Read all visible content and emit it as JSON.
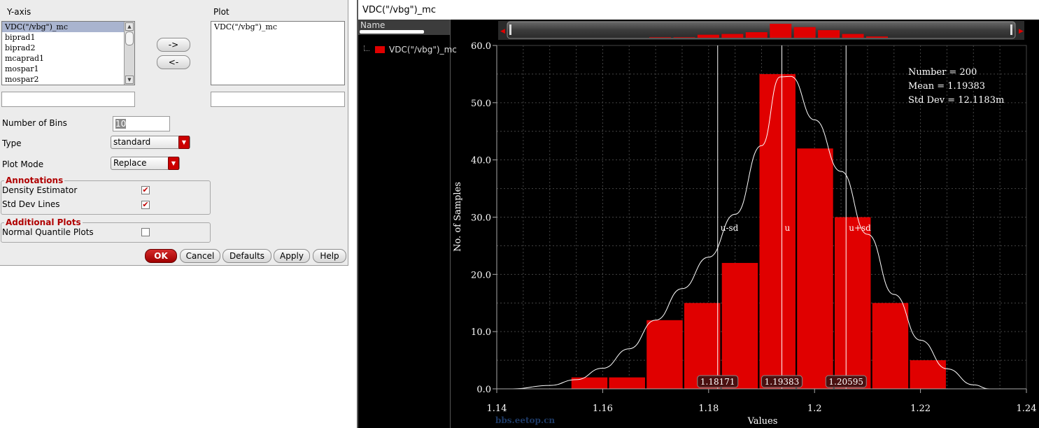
{
  "dialog": {
    "yaxis_label": "Y-axis",
    "plot_label": "Plot",
    "yaxis_items": [
      {
        "label": "VDC(\"/vbg\")_mc",
        "selected": true
      },
      {
        "label": "biprad1",
        "selected": false
      },
      {
        "label": "biprad2",
        "selected": false
      },
      {
        "label": "mcaprad1",
        "selected": false
      },
      {
        "label": "mospar1",
        "selected": false
      },
      {
        "label": "mospar2",
        "selected": false
      }
    ],
    "plot_items": [
      "VDC(\"/vbg\")_mc"
    ],
    "add_button": "->",
    "remove_button": "<-",
    "bins_label": "Number of Bins",
    "bins_value": "10",
    "type_label": "Type",
    "type_value": "standard",
    "plot_mode_label": "Plot Mode",
    "plot_mode_value": "Replace",
    "annotations_title": "Annotations",
    "density_label": "Density Estimator",
    "density_checked": true,
    "stddev_label": "Std Dev Lines",
    "stddev_checked": true,
    "additional_title": "Additional Plots",
    "quantile_label": "Normal Quantile Plots",
    "quantile_checked": false,
    "buttons": {
      "ok": "OK",
      "cancel": "Cancel",
      "defaults": "Defaults",
      "apply": "Apply",
      "help": "Help"
    }
  },
  "plot_window": {
    "title": "VDC(\"/vbg\")_mc",
    "legend_header": "Name",
    "legend_item": "VDC(\"/vbg\")_mc",
    "series_color": "#e00000",
    "watermark": "bbs.eetop.cn"
  },
  "chart_data": {
    "type": "bar",
    "xlabel": "Values",
    "ylabel": "No. of Samples",
    "xlim": [
      1.14,
      1.24
    ],
    "ylim": [
      0,
      60
    ],
    "xticks": [
      1.14,
      1.16,
      1.18,
      1.2,
      1.22,
      1.24
    ],
    "xtick_labels": [
      "1.14",
      "1.16",
      "1.18",
      "1.2",
      "1.22",
      "1.24"
    ],
    "yticks": [
      0,
      10,
      20,
      30,
      40,
      50,
      60
    ],
    "ytick_labels": [
      "0.0",
      "10.0",
      "20.0",
      "30.0",
      "40.0",
      "50.0",
      "60.0"
    ],
    "bins": [
      {
        "x0": 1.1541,
        "x1": 1.1609,
        "count": 2
      },
      {
        "x0": 1.1612,
        "x1": 1.168,
        "count": 2
      },
      {
        "x0": 1.1683,
        "x1": 1.1751,
        "count": 12
      },
      {
        "x0": 1.1754,
        "x1": 1.1822,
        "count": 15
      },
      {
        "x0": 1.1825,
        "x1": 1.1893,
        "count": 22
      },
      {
        "x0": 1.1896,
        "x1": 1.1964,
        "count": 55
      },
      {
        "x0": 1.1967,
        "x1": 1.2035,
        "count": 42
      },
      {
        "x0": 1.2038,
        "x1": 1.2106,
        "count": 30
      },
      {
        "x0": 1.2109,
        "x1": 1.2177,
        "count": 15
      },
      {
        "x0": 1.218,
        "x1": 1.2248,
        "count": 5
      }
    ],
    "density_curve": [
      [
        1.143,
        0.0
      ],
      [
        1.15,
        0.6
      ],
      [
        1.155,
        1.6
      ],
      [
        1.16,
        3.6
      ],
      [
        1.165,
        7.0
      ],
      [
        1.17,
        12.0
      ],
      [
        1.175,
        17.5
      ],
      [
        1.18,
        23.0
      ],
      [
        1.185,
        30.5
      ],
      [
        1.19,
        42.5
      ],
      [
        1.1935,
        54.5
      ],
      [
        1.1955,
        54.6
      ],
      [
        1.2,
        47.0
      ],
      [
        1.205,
        38.0
      ],
      [
        1.21,
        27.0
      ],
      [
        1.215,
        16.5
      ],
      [
        1.22,
        8.5
      ],
      [
        1.225,
        3.5
      ],
      [
        1.23,
        0.7
      ],
      [
        1.233,
        0.0
      ]
    ],
    "stddev_lines": [
      {
        "x": 1.18171,
        "label": "u-sd",
        "value_label": "1.18171"
      },
      {
        "x": 1.19383,
        "label": "u",
        "value_label": "1.19383"
      },
      {
        "x": 1.20595,
        "label": "u+sd",
        "value_label": "1.20595"
      }
    ],
    "stats": [
      "Number = 200",
      "Mean = 1.19383",
      "Std Dev = 12.1183m"
    ],
    "grid": true,
    "bar_color": "#e00000"
  }
}
